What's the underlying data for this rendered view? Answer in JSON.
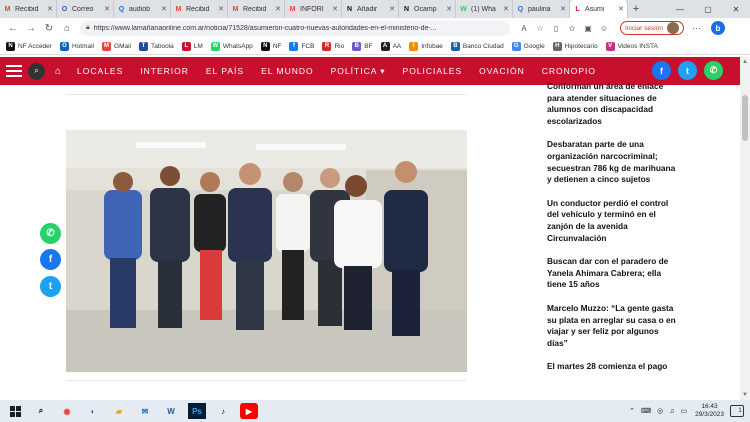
{
  "browser": {
    "tabs": [
      {
        "label": "Recibid",
        "icon": "M",
        "color": "#ea4335"
      },
      {
        "label": "Correo",
        "icon": "O",
        "color": "#0a64c8"
      },
      {
        "label": "audiob",
        "icon": "Q",
        "color": "#1a73e8"
      },
      {
        "label": "Recibid",
        "icon": "M",
        "color": "#ea4335"
      },
      {
        "label": "Recibid",
        "icon": "M",
        "color": "#ea4335"
      },
      {
        "label": "INFORI",
        "icon": "M",
        "color": "#ea4335"
      },
      {
        "label": "Añadir",
        "icon": "N",
        "color": "#111111"
      },
      {
        "label": "Ocamp",
        "icon": "N",
        "color": "#111111"
      },
      {
        "label": "(1) Wha",
        "icon": "W",
        "color": "#25d366"
      },
      {
        "label": "paulina",
        "icon": "Q",
        "color": "#1a73e8"
      },
      {
        "label": "Asumi",
        "icon": "L",
        "color": "#c8102e",
        "active": true
      }
    ],
    "new_tab": "+",
    "url": "https://www.lamañanaonline.com.ar/noticia/71528/asumieron-cuatro-nuevas-autoridades-en-el-ministerio-de-...",
    "sign_in": "Iniciar sesión",
    "bookmarks": [
      {
        "label": "NF Acceder",
        "icon": "N",
        "color": "#111111"
      },
      {
        "label": "Hotmail",
        "icon": "O",
        "color": "#0a64c8"
      },
      {
        "label": "GMail",
        "icon": "M",
        "color": "#ea4335"
      },
      {
        "label": "Taboola",
        "icon": "T",
        "color": "#1e4aa8"
      },
      {
        "label": "LM",
        "icon": "L",
        "color": "#c8102e"
      },
      {
        "label": "WhatsApp",
        "icon": "W",
        "color": "#25d366"
      },
      {
        "label": "NF",
        "icon": "N",
        "color": "#111111"
      },
      {
        "label": "FCB",
        "icon": "f",
        "color": "#1877f2"
      },
      {
        "label": "Rio",
        "icon": "R",
        "color": "#d62828"
      },
      {
        "label": "BF",
        "icon": "B",
        "color": "#6a5acd"
      },
      {
        "label": "AA",
        "icon": "A",
        "color": "#222222"
      },
      {
        "label": "Infobae",
        "icon": "I",
        "color": "#f28c00"
      },
      {
        "label": "Banco Ciudad",
        "icon": "B",
        "color": "#1a5fb4"
      },
      {
        "label": "Google",
        "icon": "G",
        "color": "#4285f4"
      },
      {
        "label": "Hipotecario",
        "icon": "H",
        "color": "#666666"
      },
      {
        "label": "Videos INSTA",
        "icon": "V",
        "color": "#c13584"
      }
    ]
  },
  "site": {
    "nav_items": [
      "LOCALES",
      "INTERIOR",
      "EL PAÍS",
      "EL MUNDO",
      "POLÍTICA ▾",
      "POLICIALES",
      "OVACIÓN",
      "CRONOPIO"
    ],
    "colors": {
      "brand": "#c8102e",
      "facebook": "#1877f2",
      "twitter": "#1da1f2",
      "whatsapp": "#25d366"
    }
  },
  "sidebar_news": [
    "Conforman un área de enlace para atender situaciones de alumnos con discapacidad escolarizados",
    "Desbaratan parte de una organización narcocriminal; secuestran 786 kg de marihuana y detienen a cinco sujetos",
    "Un conductor perdió el control del vehículo y terminó en el zanjón de la avenida Circunvalación",
    "Buscan dar con el  paradero de Yanela  Ahimara Cabrera; ella tiene 15 años",
    "Marcelo Muzzo: “La gente gasta su plata en arreglar su casa o en viajar y ser feliz por algunos días”",
    "El martes 28 comienza el pago"
  ],
  "taskbar": {
    "time": "16:43",
    "date": "29/3/2023",
    "notifications": "1"
  }
}
